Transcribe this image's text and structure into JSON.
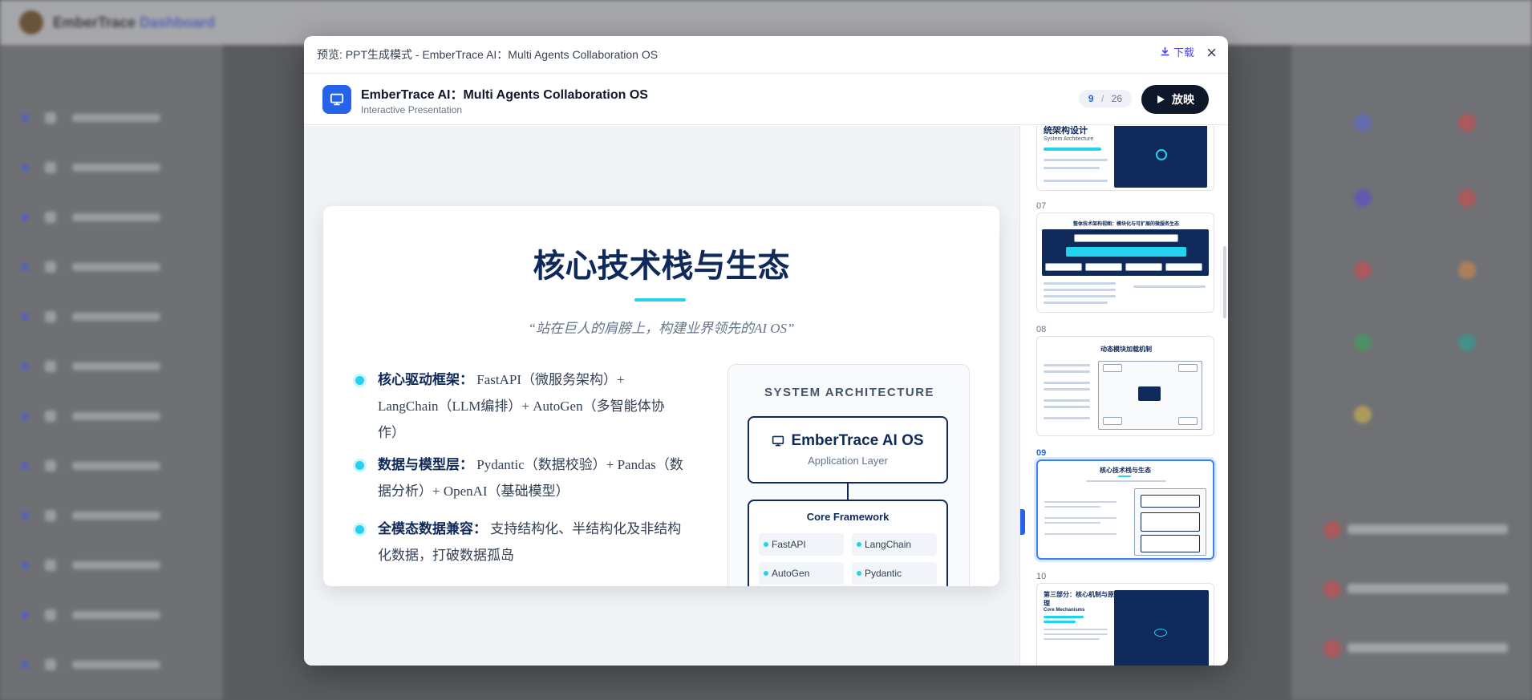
{
  "background": {
    "brand_name": "EmberTrace",
    "brand_accent": "Dashboard"
  },
  "modal": {
    "title": "预览: PPT生成模式 - EmberTrace AI：Multi Agents Collaboration OS",
    "download_label": "下载",
    "close_label": "×"
  },
  "deck": {
    "title": "EmberTrace AI：Multi Agents Collaboration OS",
    "subtitle": "Interactive Presentation",
    "current_page": "9",
    "total_pages": "26",
    "play_label": "放映"
  },
  "slide": {
    "title": "核心技术栈与生态",
    "quote": "“站在巨人的肩膀上，构建业界领先的AI OS”",
    "bullets": [
      {
        "label": "核心驱动框架：",
        "text": "FastAPI（微服务架构）+ LangChain（LLM编排）+ AutoGen（多智能体协作）"
      },
      {
        "label": "数据与模型层：",
        "text": "Pydantic（数据校验）+ Pandas（数据分析）+ OpenAI（基础模型）"
      },
      {
        "label": "全模态数据兼容：",
        "text": "支持结构化、半结构化及非结构化数据，打破数据孤岛"
      }
    ],
    "arch": {
      "label": "SYSTEM ARCHITECTURE",
      "os_title": "EmberTrace AI OS",
      "os_sub": "Application Layer",
      "core_title": "Core Framework",
      "chips": [
        "FastAPI",
        "LangChain",
        "AutoGen",
        "Pydantic"
      ]
    }
  },
  "thumbnails": [
    {
      "num": "",
      "title": "统架构设计",
      "subtitle": "System Architecture"
    },
    {
      "num": "07",
      "title": "整体技术架构视图：模块化与可扩展的微服务生态"
    },
    {
      "num": "08",
      "title": "动态模块加载机制"
    },
    {
      "num": "09",
      "title": "核心技术栈与生态"
    },
    {
      "num": "10",
      "title": "第三部分：核心机制与原理",
      "subtitle": "Core Mechanisms"
    }
  ],
  "colors": {
    "accent": "#2563eb",
    "navy": "#0f2a5a",
    "cyan": "#22d3ee",
    "play_button": "#0f172a"
  },
  "icons": {
    "download": "download-icon",
    "close": "close-icon",
    "deck": "monitor-icon",
    "play": "play-icon",
    "arch_os": "monitor-icon"
  }
}
